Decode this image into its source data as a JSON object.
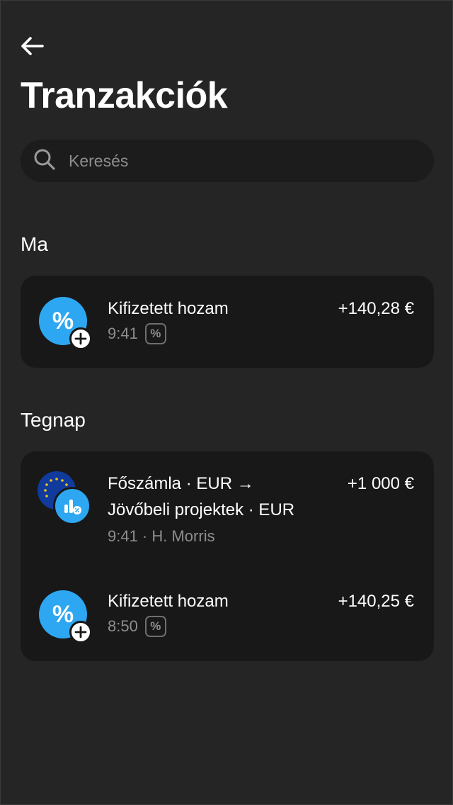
{
  "header": {
    "title": "Tranzakciók",
    "back_icon": "arrow-left-icon"
  },
  "search": {
    "placeholder": "Keresés",
    "value": "",
    "icon": "search-icon"
  },
  "sections": [
    {
      "label": "Ma",
      "transactions": [
        {
          "title": "Kifizetett hozam",
          "amount": "+140,28 €",
          "time": "9:41",
          "badge": "%",
          "icon": "yield-percent-icon"
        }
      ]
    },
    {
      "label": "Tegnap",
      "transactions": [
        {
          "title_line1": "Főszámla · EUR →",
          "title_line2": "Jövőbeli projektek · EUR",
          "amount": "+1 000 €",
          "meta": "9:41 · H. Morris",
          "icon": "transfer-eu-flag-icon"
        },
        {
          "title": "Kifizetett hozam",
          "amount": "+140,25 €",
          "time": "8:50",
          "badge": "%",
          "icon": "yield-percent-icon"
        }
      ]
    }
  ],
  "colors": {
    "background": "#252525",
    "card": "#181818",
    "accent": "#2ea7f2",
    "muted_text": "#8e8e8e"
  }
}
